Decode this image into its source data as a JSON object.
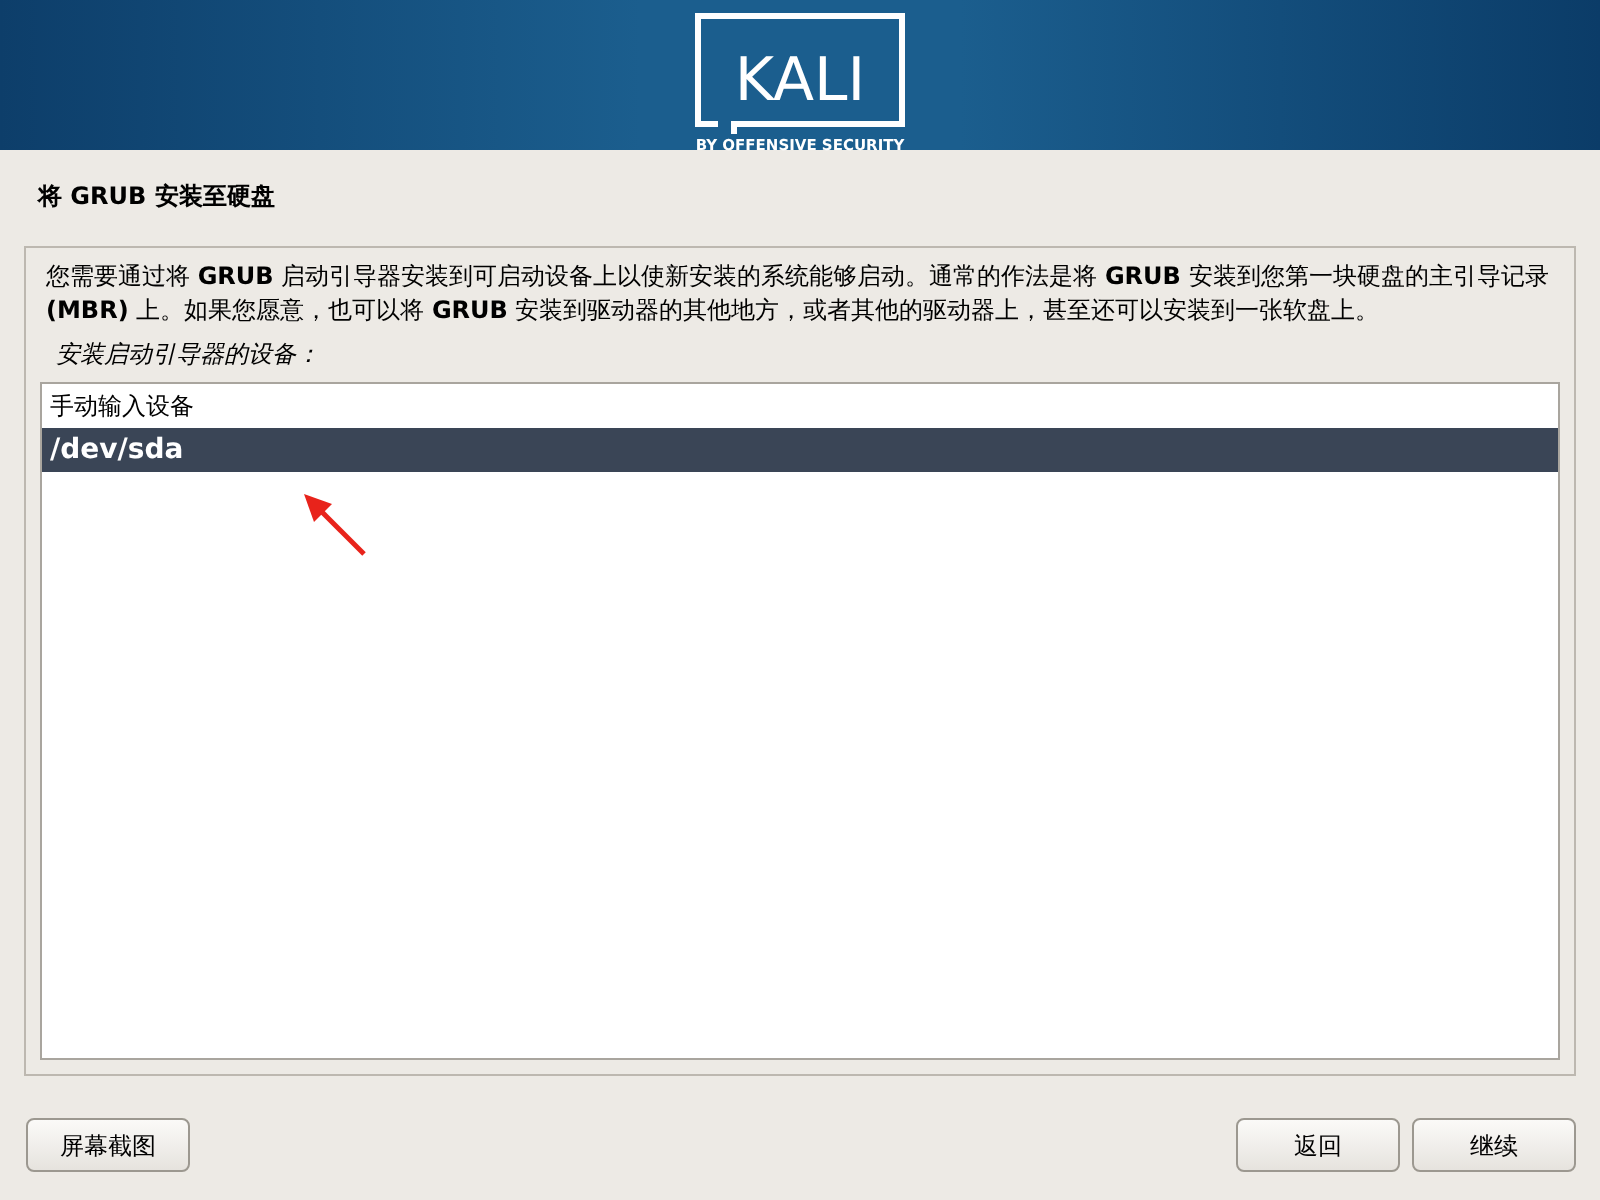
{
  "header": {
    "logo_text": "KALI",
    "logo_tagline": "BY OFFENSIVE SECURITY"
  },
  "title": "将 GRUB 安装至硬盘",
  "description": "您需要通过将 **GRUB** 启动引导器安装到可启动设备上以使新安装的系统能够启动。通常的作法是将 **GRUB** 安装到您第一块硬盘的主引导记录 **(MBR)** 上。如果您愿意，也可以将 **GRUB** 安装到驱动器的其他地方，或者其他的驱动器上，甚至还可以安装到一张软盘上。",
  "list_label": "安装启动引导器的设备：",
  "devices": [
    {
      "label": "手动输入设备",
      "selected": false
    },
    {
      "label": "/dev/sda",
      "selected": true
    }
  ],
  "buttons": {
    "screenshot": "屏幕截图",
    "back": "返回",
    "continue": "继续"
  }
}
